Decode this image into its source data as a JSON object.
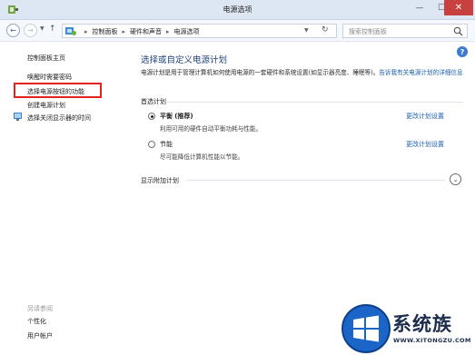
{
  "window": {
    "title": "电源选项"
  },
  "nav": {
    "breadcrumbs": [
      "控制面板",
      "硬件和声音",
      "电源选项"
    ],
    "search_placeholder": "搜索控制面板"
  },
  "sidebar": {
    "home": "控制面板主页",
    "items": [
      "唤醒时需要密码",
      "选择电源按钮的功能",
      "创建电源计划",
      "选择关闭显示器的时间"
    ],
    "see_also_label": "另请参阅",
    "see_also_items": [
      "个性化",
      "用户帐户"
    ]
  },
  "main": {
    "title": "选择或自定义电源计划",
    "description": "电源计划是用于管理计算机如何使用电源的一套硬件和系统设置(如显示器亮度、睡眠等)。",
    "description_link": "告诉我有关电源计划的详细信息",
    "preferred_section": "首选计划",
    "plans": [
      {
        "name": "平衡",
        "tag": "(推荐)",
        "desc": "利用可用的硬件自动平衡功耗与性能。",
        "link": "更改计划设置",
        "selected": true
      },
      {
        "name": "节能",
        "tag": "",
        "desc": "尽可能降低计算机性能以节能。",
        "link": "更改计划设置",
        "selected": false
      }
    ],
    "more_plans": "显示附加计划"
  },
  "watermark": {
    "brand": "系统族",
    "url": "WWW.XITONGZU.COM"
  },
  "colors": {
    "highlight": "#e2221c",
    "link": "#1a5fb4",
    "title": "#1f3f7a"
  }
}
